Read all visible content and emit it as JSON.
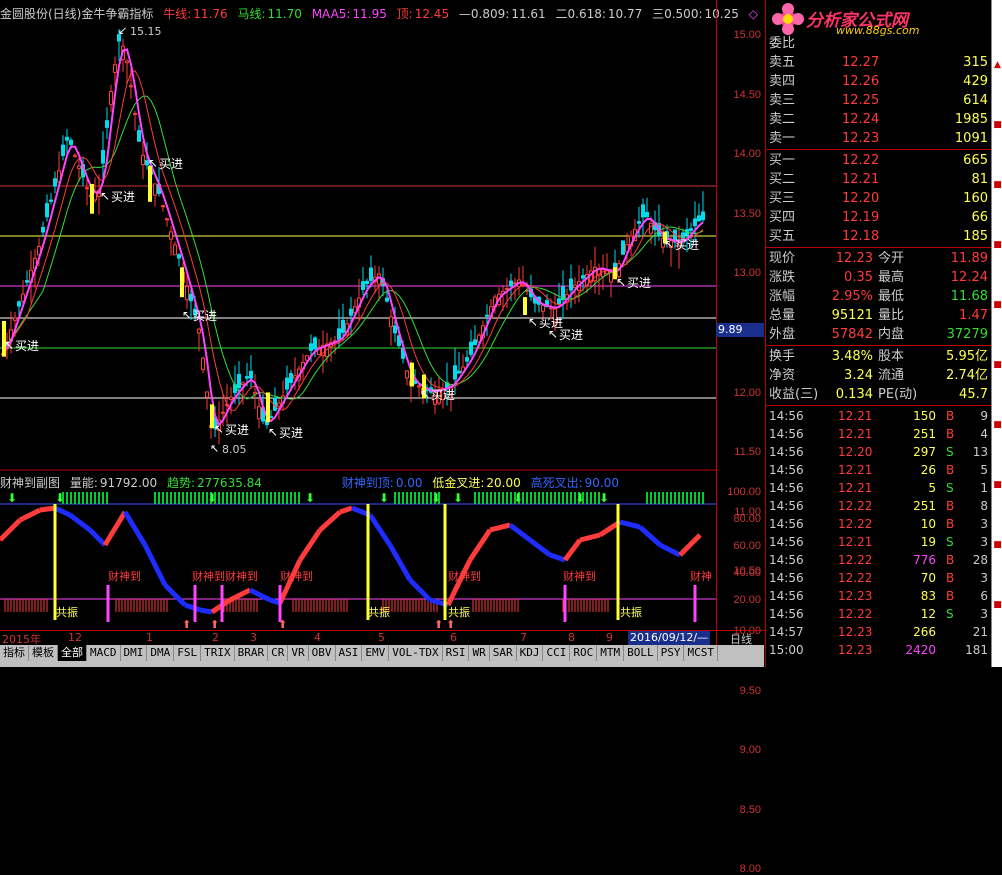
{
  "title": {
    "stock": "金圆股份(日线)",
    "indicator": "金牛争霸指标",
    "niuxian_label": "牛线:",
    "niuxian_value": "11.76",
    "maxian_label": "马线:",
    "maxian_value": "11.70",
    "maa5_label": "MAA5:",
    "maa5_value": "11.95",
    "ding_label": "顶:",
    "ding_value": "12.45",
    "fib1_label": "—0.809:",
    "fib1_value": "11.61",
    "fib2_label": "二0.618:",
    "fib2_value": "10.77",
    "fib3_label": "三0.500:",
    "fib3_value": "10.25"
  },
  "price_axis": [
    "15.00",
    "14.50",
    "14.00",
    "13.50",
    "13.00",
    "12.50",
    "12.00",
    "11.50",
    "11.00",
    "10.50",
    "10.00",
    "9.50",
    "9.00",
    "8.50",
    "8.00"
  ],
  "current_price_tag": "9.89",
  "annotations": {
    "high_label": "15.15",
    "low_label": "8.05",
    "buy_label": "买进"
  },
  "indicator_title": {
    "name": "财神到副图",
    "volume_label": "量能:",
    "volume_value": "91792.00",
    "trend_label": "趋势:",
    "trend_value": "277635.84",
    "arrival_label": "财神到顶:",
    "arrival_value": "0.00",
    "lowgold_label": "低金叉进:",
    "lowgold_value": "20.00",
    "highdead_label": "高死叉出:",
    "highdead_value": "90.00"
  },
  "ind_axis": [
    "100.00",
    "80.00",
    "60.00",
    "40.00",
    "20.00"
  ],
  "ind_labels": {
    "caishen": "财神到",
    "caishen2": "财神到财神到",
    "caishen_short": "财神",
    "gongzhen": "共振"
  },
  "date_axis": {
    "labels": [
      "2015年",
      "12",
      "1",
      "2",
      "3",
      "4",
      "5",
      "6",
      "7",
      "8",
      "9"
    ],
    "badge": "2016/09/12/—",
    "period": "日线"
  },
  "tabs": [
    "指标",
    "模板",
    "全部",
    "MACD",
    "DMI",
    "DMA",
    "FSL",
    "TRIX",
    "BRAR",
    "CR",
    "VR",
    "OBV",
    "ASI",
    "EMV",
    "VOL-TDX",
    "RSI",
    "WR",
    "SAR",
    "KDJ",
    "CCI",
    "ROC",
    "MTM",
    "BOLL",
    "PSY",
    "MCST"
  ],
  "logo": {
    "text": "分析家公式网",
    "url": "www.88gs.com"
  },
  "quote": {
    "weibi_label": "委比",
    "asks": [
      {
        "label": "卖五",
        "price": "12.27",
        "vol": "315"
      },
      {
        "label": "卖四",
        "price": "12.26",
        "vol": "429"
      },
      {
        "label": "卖三",
        "price": "12.25",
        "vol": "614"
      },
      {
        "label": "卖二",
        "price": "12.24",
        "vol": "1985"
      },
      {
        "label": "卖一",
        "price": "12.23",
        "vol": "1091"
      }
    ],
    "bids": [
      {
        "label": "买一",
        "price": "12.22",
        "vol": "665"
      },
      {
        "label": "买二",
        "price": "12.21",
        "vol": "81"
      },
      {
        "label": "买三",
        "price": "12.20",
        "vol": "160"
      },
      {
        "label": "买四",
        "price": "12.19",
        "vol": "66"
      },
      {
        "label": "买五",
        "price": "12.18",
        "vol": "185"
      }
    ],
    "stats": [
      {
        "l1": "现价",
        "v1": "12.23",
        "l2": "今开",
        "v2": "11.89"
      },
      {
        "l1": "涨跌",
        "v1": "0.35",
        "l2": "最高",
        "v2": "12.24"
      },
      {
        "l1": "涨幅",
        "v1": "2.95%",
        "l2": "最低",
        "v2": "11.68"
      },
      {
        "l1": "总量",
        "v1": "95121",
        "l2": "量比",
        "v2": "1.47"
      },
      {
        "l1": "外盘",
        "v1": "57842",
        "l2": "内盘",
        "v2": "37279"
      }
    ],
    "stats2": [
      {
        "l1": "换手",
        "v1": "3.48%",
        "l2": "股本",
        "v2": "5.95亿"
      },
      {
        "l1": "净资",
        "v1": "3.24",
        "l2": "流通",
        "v2": "2.74亿"
      },
      {
        "l1": "收益(三)",
        "v1": "0.134",
        "l2": "PE(动)",
        "v2": "45.7"
      }
    ],
    "ticks": [
      {
        "time": "14:56",
        "price": "12.21",
        "vol": "150",
        "bs": "B",
        "n": "9"
      },
      {
        "time": "14:56",
        "price": "12.21",
        "vol": "251",
        "bs": "B",
        "n": "4"
      },
      {
        "time": "14:56",
        "price": "12.20",
        "vol": "297",
        "bs": "S",
        "n": "13"
      },
      {
        "time": "14:56",
        "price": "12.21",
        "vol": "26",
        "bs": "B",
        "n": "5"
      },
      {
        "time": "14:56",
        "price": "12.21",
        "vol": "5",
        "bs": "S",
        "n": "1"
      },
      {
        "time": "14:56",
        "price": "12.22",
        "vol": "251",
        "bs": "B",
        "n": "8"
      },
      {
        "time": "14:56",
        "price": "12.22",
        "vol": "10",
        "bs": "B",
        "n": "3"
      },
      {
        "time": "14:56",
        "price": "12.21",
        "vol": "19",
        "bs": "S",
        "n": "3"
      },
      {
        "time": "14:56",
        "price": "12.22",
        "vol": "776",
        "bs": "B",
        "n": "28"
      },
      {
        "time": "14:56",
        "price": "12.22",
        "vol": "70",
        "bs": "B",
        "n": "3"
      },
      {
        "time": "14:56",
        "price": "12.23",
        "vol": "83",
        "bs": "B",
        "n": "6"
      },
      {
        "time": "14:56",
        "price": "12.22",
        "vol": "12",
        "bs": "S",
        "n": "3"
      },
      {
        "time": "14:57",
        "price": "12.23",
        "vol": "266",
        "bs": "",
        "n": "21"
      },
      {
        "time": "15:00",
        "price": "12.23",
        "vol": "2420",
        "bs": "",
        "n": "181"
      }
    ]
  },
  "colors": {
    "up": "#ff3b3b",
    "down": "#00cc66",
    "yellow": "#ffff55",
    "magenta": "#ff44ff",
    "blue": "#2a3cff"
  }
}
